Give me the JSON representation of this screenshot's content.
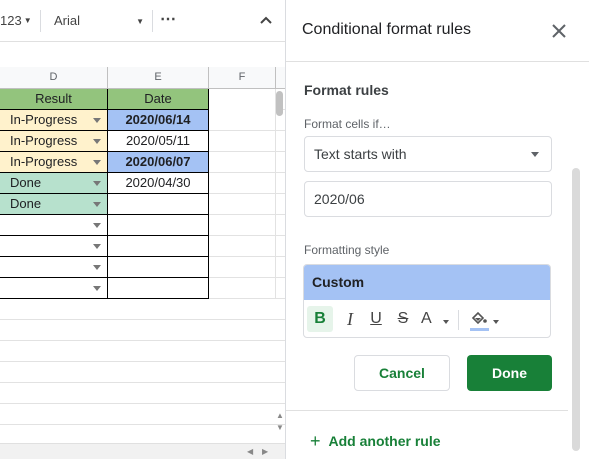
{
  "toolbar": {
    "number_format": "123",
    "font": "Arial"
  },
  "sheet": {
    "columns": [
      "D",
      "E",
      "F"
    ],
    "header_row": {
      "result": "Result",
      "date": "Date"
    },
    "rows": [
      {
        "result": "In-Progress",
        "date": "2020/06/14",
        "result_color": "#fff2cc",
        "date_color": "#a4c2f4",
        "date_bold": true,
        "dropdown": true
      },
      {
        "result": "In-Progress",
        "date": "2020/05/11",
        "result_color": "#fff2cc",
        "date_color": "#ffffff",
        "date_bold": false,
        "dropdown": true
      },
      {
        "result": "In-Progress",
        "date": "2020/06/07",
        "result_color": "#fff2cc",
        "date_color": "#a4c2f4",
        "date_bold": true,
        "dropdown": true
      },
      {
        "result": "Done",
        "date": "2020/04/30",
        "result_color": "#b7e1cd",
        "date_color": "#ffffff",
        "date_bold": false,
        "dropdown": true
      },
      {
        "result": "Done",
        "date": "",
        "result_color": "#b7e1cd",
        "date_color": "#ffffff",
        "date_bold": false,
        "dropdown": true
      },
      {
        "result": "",
        "date": "",
        "result_color": "#ffffff",
        "date_color": "#ffffff",
        "date_bold": false,
        "dropdown": true
      },
      {
        "result": "",
        "date": "",
        "result_color": "#ffffff",
        "date_color": "#ffffff",
        "date_bold": false,
        "dropdown": true
      },
      {
        "result": "",
        "date": "",
        "result_color": "#ffffff",
        "date_color": "#ffffff",
        "date_bold": false,
        "dropdown": true
      },
      {
        "result": "",
        "date": "",
        "result_color": "#ffffff",
        "date_color": "#ffffff",
        "date_bold": false,
        "dropdown": true
      }
    ],
    "header_color": "#93c47d"
  },
  "panel": {
    "title": "Conditional format rules",
    "section_heading": "Format rules",
    "condition_label": "Format cells if…",
    "condition_value": "Text starts with",
    "value": "2020/06",
    "formatting_style_label": "Formatting style",
    "style_preview": "Custom",
    "style_fill_color": "#a4c2f4",
    "cancel_label": "Cancel",
    "done_label": "Done",
    "add_rule_label": "Add another rule",
    "accent_color": "#188038"
  }
}
